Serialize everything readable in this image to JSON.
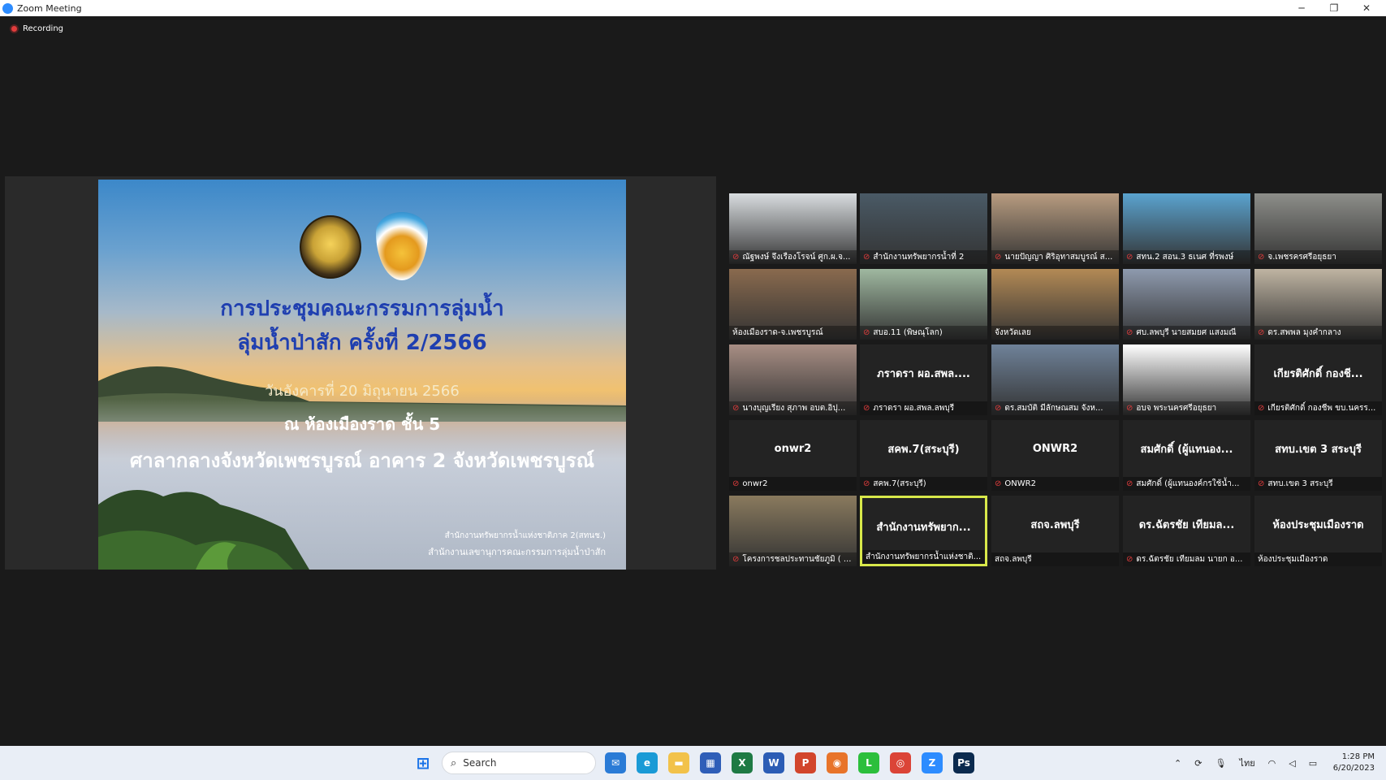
{
  "window": {
    "title": "Zoom Meeting",
    "controls": {
      "minimize": "─",
      "maximize": "❐",
      "close": "✕"
    }
  },
  "recording": {
    "label": "Recording"
  },
  "slide": {
    "line1": "การประชุมคณะกรรมการลุ่มน้ำ",
    "line2": "ลุ่มน้ำป่าสัก ครั้งที่ 2/2566",
    "line3": "วันอังคารที่ 20 มิถุนายน 2566",
    "line4": "ณ ห้องเมืองราด ชั้น 5",
    "line5": "ศาลากลางจังหวัดเพชรบูรณ์ อาคาร 2 จังหวัดเพชรบูรณ์",
    "footer1": "สำนักงานทรัพยากรน้ำแห่งชาติภาค 2(สทนช.)",
    "footer2": "สำนักงานเลขานุการคณะกรรมการลุ่มน้ำป่าสัก"
  },
  "participants": [
    {
      "label": "ณัฐพงษ์ จึงเรืองโรจน์ ศูก.ผ.จ...",
      "video": true,
      "muted": true,
      "bg": "#d9dde0"
    },
    {
      "label": "สำนักงานทรัพยากรน้ำที่ 2",
      "video": true,
      "muted": true,
      "bg": "#4a5a66"
    },
    {
      "label": "นายปัญญา ศิริอุทาสมบูรณ์ ส...",
      "video": true,
      "muted": true,
      "bg": "#b89c80"
    },
    {
      "label": "สทน.2 สอน.3 ธเนศ ที่รพงษ์",
      "video": true,
      "muted": true,
      "bg": "#5aa3cf"
    },
    {
      "label": "จ.เพชรครศรีอยุธยา",
      "video": true,
      "muted": true,
      "bg": "#8d8e8a"
    },
    {
      "label": "ห้องเมืองราด-จ.เพชรบูรณ์",
      "video": true,
      "muted": false,
      "bg": "#8a6a4e"
    },
    {
      "label": "สบอ.11 (พิษณุโลก)",
      "video": true,
      "muted": true,
      "bg": "#9fb8a0"
    },
    {
      "label": "จังหวัดเลย",
      "video": true,
      "muted": false,
      "bg": "#b38a55"
    },
    {
      "label": "ศบ.ลพบุรี นายสมยศ แสงมณี",
      "video": true,
      "muted": true,
      "bg": "#8e9aae"
    },
    {
      "label": "ดร.สพพล มุงคำกลาง",
      "video": true,
      "muted": true,
      "bg": "#bfb4a2"
    },
    {
      "label": "นางบุญเรียง สุภาพ อบต.อิปุ...",
      "video": true,
      "muted": true,
      "bg": "#a88e84"
    },
    {
      "label": "ภราดรา ผอ.สพล.ลพบุรี",
      "name": "ภราดรา ผอ.สพล....",
      "video": false,
      "muted": true
    },
    {
      "label": "ดร.สมบัติ มีลักษณสม จังห...",
      "video": true,
      "muted": true,
      "bg": "#6f8299"
    },
    {
      "label": "อบจ พระนครศรีอยุธยา",
      "video": true,
      "muted": true,
      "bg": "#ffffff"
    },
    {
      "label": "เกียรติศักดิ์ กองชีพ ขบ.นครร...",
      "name": "เกียรติศักดิ์ กองชี...",
      "video": false,
      "muted": true
    },
    {
      "label": "onwr2",
      "name": "onwr2",
      "video": false,
      "muted": true
    },
    {
      "label": "สคพ.7(สระบุรี)",
      "name": "สคพ.7(สระบุรี)",
      "video": false,
      "muted": true
    },
    {
      "label": "ONWR2",
      "name": "ONWR2",
      "video": false,
      "muted": true
    },
    {
      "label": "สมศักดิ์ (ผู้แทนองค์กรใช้น้ำ...",
      "name": "สมศักดิ์ (ผู้แทนอง...",
      "video": false,
      "muted": true
    },
    {
      "label": "สทบ.เขต 3 สระบุรี",
      "name": "สทบ.เขต 3 สระบุรี",
      "video": false,
      "muted": true
    },
    {
      "label": "โครงการชลประทานชัยภูมิ ( ...",
      "video": true,
      "muted": true,
      "bg": "#8a7a5e"
    },
    {
      "label": "สำนักงานทรัพยากรน้ำแห่งชาติ...",
      "name": "สำนักงานทรัพยาก...",
      "video": false,
      "muted": false,
      "active": true
    },
    {
      "label": "สถจ.ลพบุรี",
      "name": "สถจ.ลพบุรี",
      "video": false,
      "muted": false
    },
    {
      "label": "ดร.ฉัตรชัย เทียมลม นายก อ...",
      "name": "ดร.ฉัตรชัย เทียมล...",
      "video": false,
      "muted": true
    },
    {
      "label": "ห้องประชุมเมืองราด",
      "name": "ห้องประชุมเมืองราด",
      "video": false,
      "muted": false
    }
  ],
  "taskbar": {
    "search_placeholder": "Search",
    "apps": [
      {
        "icon": "mail-icon",
        "glyph": "✉",
        "color": "#2a7bd6"
      },
      {
        "icon": "edge-icon",
        "glyph": "e",
        "color": "#1a9ad6"
      },
      {
        "icon": "folder-icon",
        "glyph": "▬",
        "color": "#f2c24a"
      },
      {
        "icon": "store-icon",
        "glyph": "▦",
        "color": "#2f5eb8"
      },
      {
        "icon": "excel-icon",
        "glyph": "X",
        "color": "#1e7a44"
      },
      {
        "icon": "word-icon",
        "glyph": "W",
        "color": "#2b5cb5"
      },
      {
        "icon": "powerpoint-icon",
        "glyph": "P",
        "color": "#d2452c"
      },
      {
        "icon": "firefox-icon",
        "glyph": "◉",
        "color": "#e8742a"
      },
      {
        "icon": "line-icon",
        "glyph": "L",
        "color": "#2cbf3c"
      },
      {
        "icon": "chrome-icon",
        "glyph": "◎",
        "color": "#db4437"
      },
      {
        "icon": "zoom-icon",
        "glyph": "Z",
        "color": "#2d8cff"
      },
      {
        "icon": "photoshop-icon",
        "glyph": "Ps",
        "color": "#0b2a4e"
      }
    ],
    "language": "ไทย",
    "time": "1:28 PM",
    "date": "6/20/2023"
  }
}
